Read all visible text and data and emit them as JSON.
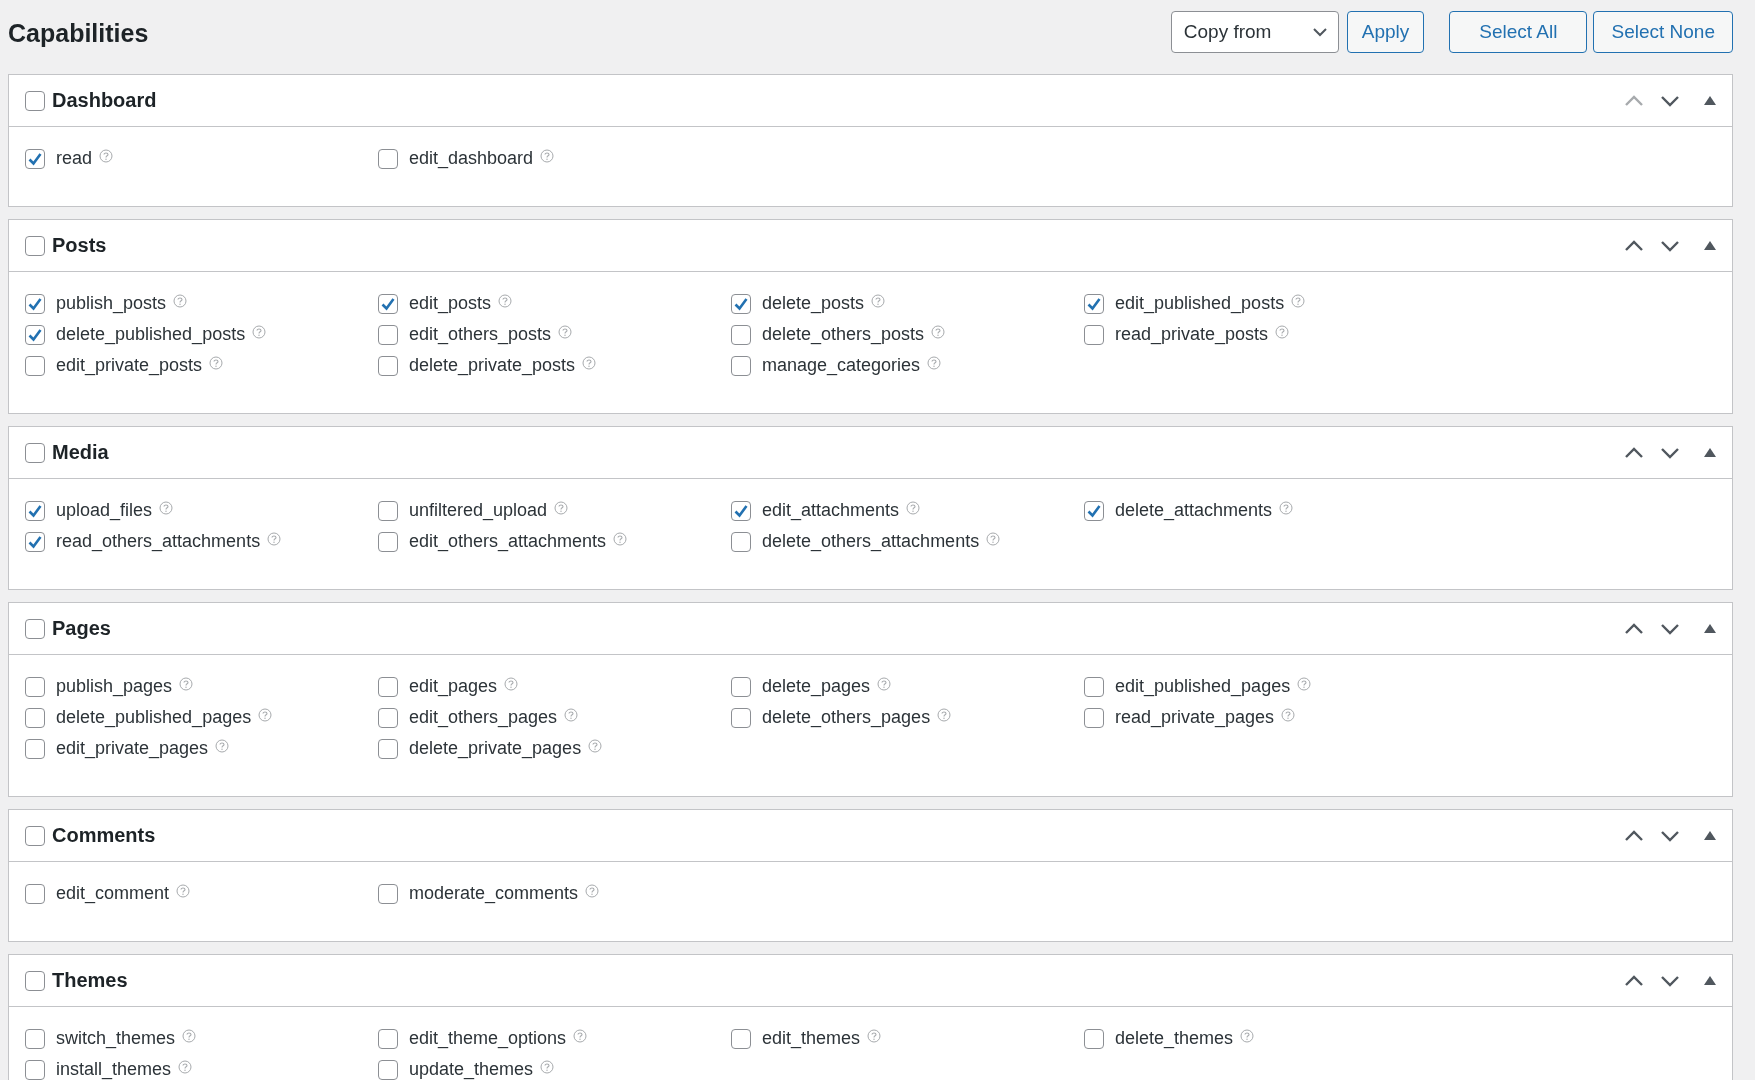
{
  "title": "Capabilities",
  "toolbar": {
    "copy_from": "Copy from",
    "apply": "Apply",
    "select_all": "Select All",
    "select_none": "Select None"
  },
  "groups": [
    {
      "title": "Dashboard",
      "checked": false,
      "up_disabled": true,
      "capabilities": [
        {
          "name": "read",
          "checked": true
        },
        {
          "name": "edit_dashboard",
          "checked": false
        }
      ]
    },
    {
      "title": "Posts",
      "checked": false,
      "up_disabled": false,
      "capabilities": [
        {
          "name": "publish_posts",
          "checked": true
        },
        {
          "name": "edit_posts",
          "checked": true
        },
        {
          "name": "delete_posts",
          "checked": true
        },
        {
          "name": "edit_published_posts",
          "checked": true
        },
        {
          "name": "delete_published_posts",
          "checked": true
        },
        {
          "name": "edit_others_posts",
          "checked": false
        },
        {
          "name": "delete_others_posts",
          "checked": false
        },
        {
          "name": "read_private_posts",
          "checked": false
        },
        {
          "name": "edit_private_posts",
          "checked": false
        },
        {
          "name": "delete_private_posts",
          "checked": false
        },
        {
          "name": "manage_categories",
          "checked": false
        }
      ]
    },
    {
      "title": "Media",
      "checked": false,
      "up_disabled": false,
      "capabilities": [
        {
          "name": "upload_files",
          "checked": true
        },
        {
          "name": "unfiltered_upload",
          "checked": false
        },
        {
          "name": "edit_attachments",
          "checked": true
        },
        {
          "name": "delete_attachments",
          "checked": true
        },
        {
          "name": "read_others_attachments",
          "checked": true
        },
        {
          "name": "edit_others_attachments",
          "checked": false
        },
        {
          "name": "delete_others_attachments",
          "checked": false
        }
      ]
    },
    {
      "title": "Pages",
      "checked": false,
      "up_disabled": false,
      "capabilities": [
        {
          "name": "publish_pages",
          "checked": false
        },
        {
          "name": "edit_pages",
          "checked": false
        },
        {
          "name": "delete_pages",
          "checked": false
        },
        {
          "name": "edit_published_pages",
          "checked": false
        },
        {
          "name": "delete_published_pages",
          "checked": false
        },
        {
          "name": "edit_others_pages",
          "checked": false
        },
        {
          "name": "delete_others_pages",
          "checked": false
        },
        {
          "name": "read_private_pages",
          "checked": false
        },
        {
          "name": "edit_private_pages",
          "checked": false
        },
        {
          "name": "delete_private_pages",
          "checked": false
        }
      ]
    },
    {
      "title": "Comments",
      "checked": false,
      "up_disabled": false,
      "capabilities": [
        {
          "name": "edit_comment",
          "checked": false
        },
        {
          "name": "moderate_comments",
          "checked": false
        }
      ]
    },
    {
      "title": "Themes",
      "checked": false,
      "up_disabled": false,
      "capabilities": [
        {
          "name": "switch_themes",
          "checked": false
        },
        {
          "name": "edit_theme_options",
          "checked": false
        },
        {
          "name": "edit_themes",
          "checked": false
        },
        {
          "name": "delete_themes",
          "checked": false
        },
        {
          "name": "install_themes",
          "checked": false
        },
        {
          "name": "update_themes",
          "checked": false
        }
      ]
    }
  ]
}
